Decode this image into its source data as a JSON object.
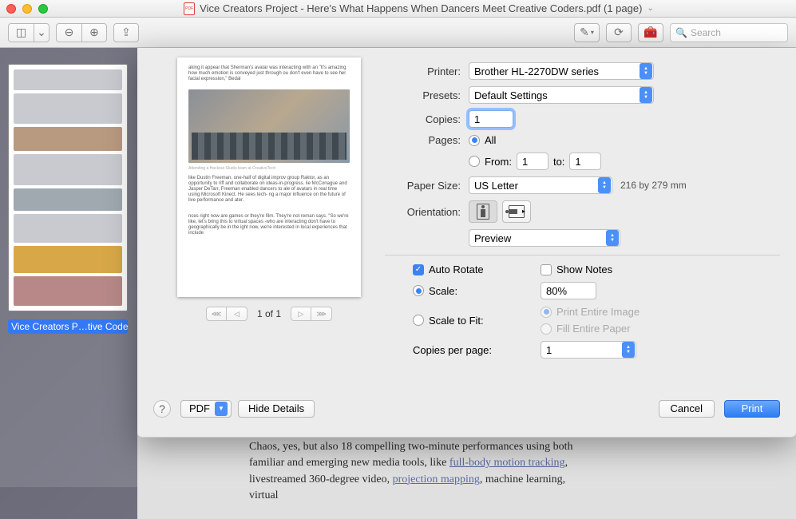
{
  "window": {
    "title": "Vice Creators Project - Here's What Happens When Dancers Meet Creative Coders.pdf (1 page)"
  },
  "toolbar": {
    "search_placeholder": "Search"
  },
  "sidebar": {
    "thumbnail_label": "Vice Creators P…tive Coder"
  },
  "dialog": {
    "labels": {
      "printer": "Printer:",
      "presets": "Presets:",
      "copies": "Copies:",
      "pages": "Pages:",
      "from": "From:",
      "to": "to:",
      "all": "All",
      "paper_size": "Paper Size:",
      "orientation": "Orientation:",
      "auto_rotate": "Auto Rotate",
      "show_notes": "Show Notes",
      "scale": "Scale:",
      "scale_to_fit": "Scale to Fit:",
      "print_entire_image": "Print Entire Image",
      "fill_entire_paper": "Fill Entire Paper",
      "copies_per_page": "Copies per page:"
    },
    "values": {
      "printer": "Brother HL-2270DW series",
      "preset": "Default Settings",
      "copies": "1",
      "pages_mode": "all",
      "from": "1",
      "to": "1",
      "paper_size": "US Letter",
      "paper_meta": "216 by 279 mm",
      "section_app": "Preview",
      "auto_rotate": true,
      "show_notes": false,
      "scale_mode": "scale",
      "scale_value": "80%",
      "copies_per_page": "1"
    },
    "preview": {
      "page_indicator": "1 of 1",
      "top_text": "aking it appear that Sherman's avatar was interacting with an \"It's amazing how much emotion is conveyed just through ou don't even have to see her facial expression,\" Bedal",
      "caption": "Attending a Hackout Studio team at CreativeTech",
      "mid_text": "like Dustin Freeman, one-half of digital improv group Raktor, as an opportunity to riff and collaborate on ideas-in-progress. lie McConague and Jasper DeTarr, Freeman enabled dancers to ale of avatars in real time using Microsoft Kinect. He sees tech- ng a major influence on the future of live performance and ater.",
      "bottom_text": "nces right now are games or they're film. They're not reman says. \"So we're like, let's bring this to virtual spaces -who are interacting don't have to geographically be in the ight now, we're interested in local experiences that include"
    },
    "footer": {
      "pdf": "PDF",
      "hide_details": "Hide Details",
      "cancel": "Cancel",
      "print": "Print"
    }
  },
  "underdoc": {
    "text_before": "Chaos, yes, but also 18 compelling two-minute performances using both familiar and emerging new media tools, like ",
    "link1": "full-body motion tracking",
    "text_mid": ", livestreamed 360-degree video, ",
    "link2": "projection mapping",
    "text_after": ", machine learning, virtual"
  }
}
